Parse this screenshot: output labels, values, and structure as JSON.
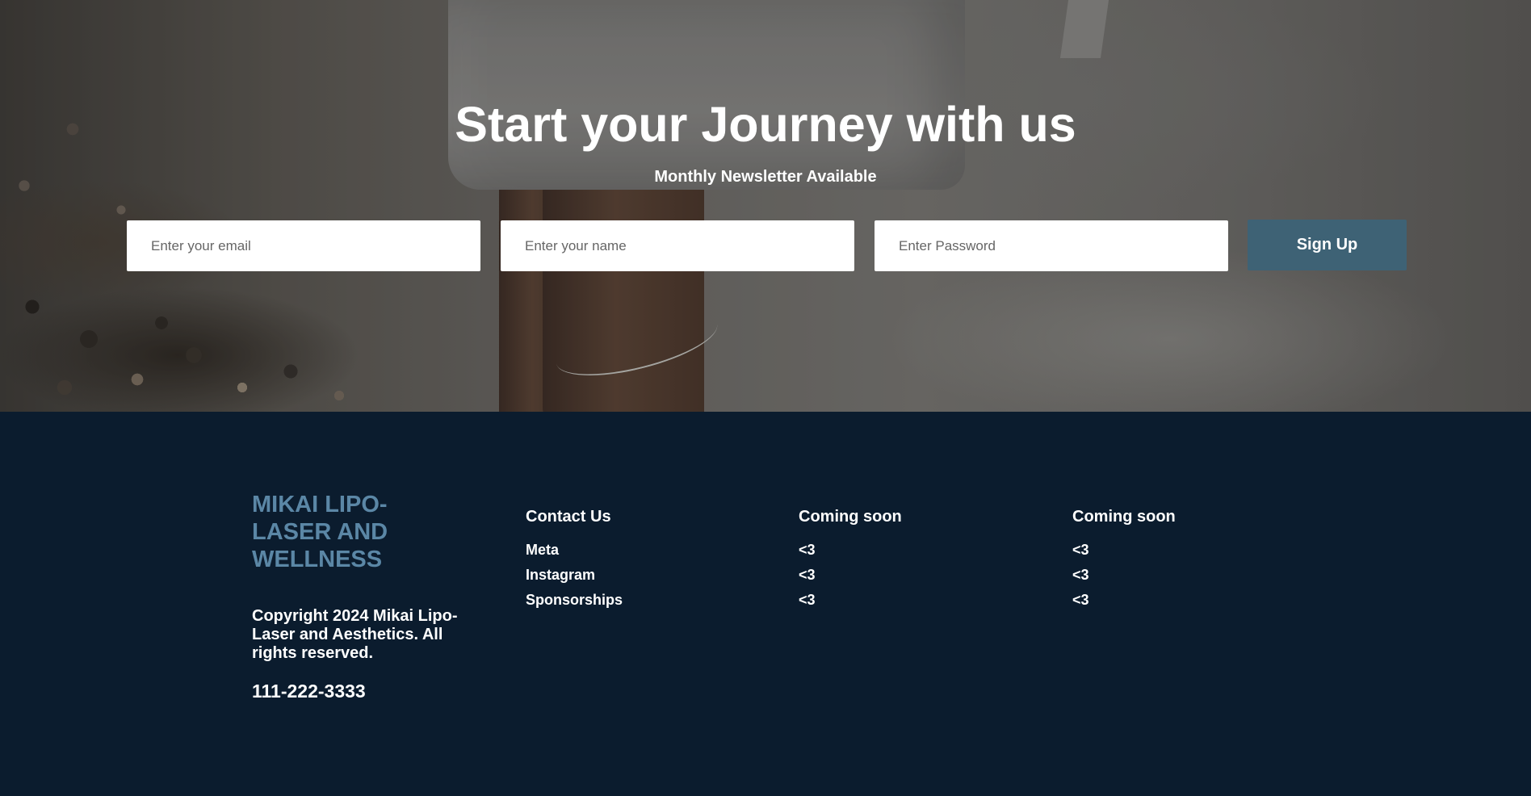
{
  "hero": {
    "title": "Start your Journey with us",
    "subtitle": "Monthly Newsletter Available"
  },
  "signup_form": {
    "email_placeholder": "Enter your email",
    "name_placeholder": "Enter your name",
    "password_placeholder": "Enter Password",
    "submit_label": "Sign Up"
  },
  "footer": {
    "brand_name": "MIKAI LIPO-LASER AND WELLNESS",
    "copyright": "Copyright 2024 Mikai Lipo-Laser and Aesthetics. All rights reserved.",
    "phone": "111-222-3333",
    "columns": [
      {
        "heading": "Contact Us",
        "links": [
          "Meta",
          "Instagram",
          "Sponsorships"
        ]
      },
      {
        "heading": "Coming soon",
        "links": [
          "<3",
          "<3",
          "<3"
        ]
      },
      {
        "heading": "Coming soon",
        "links": [
          "<3",
          "<3",
          "<3"
        ]
      }
    ]
  },
  "colors": {
    "footer_background": "#0b1c2e",
    "brand_accent": "#5b87a6",
    "button_background": "#3e6275"
  }
}
